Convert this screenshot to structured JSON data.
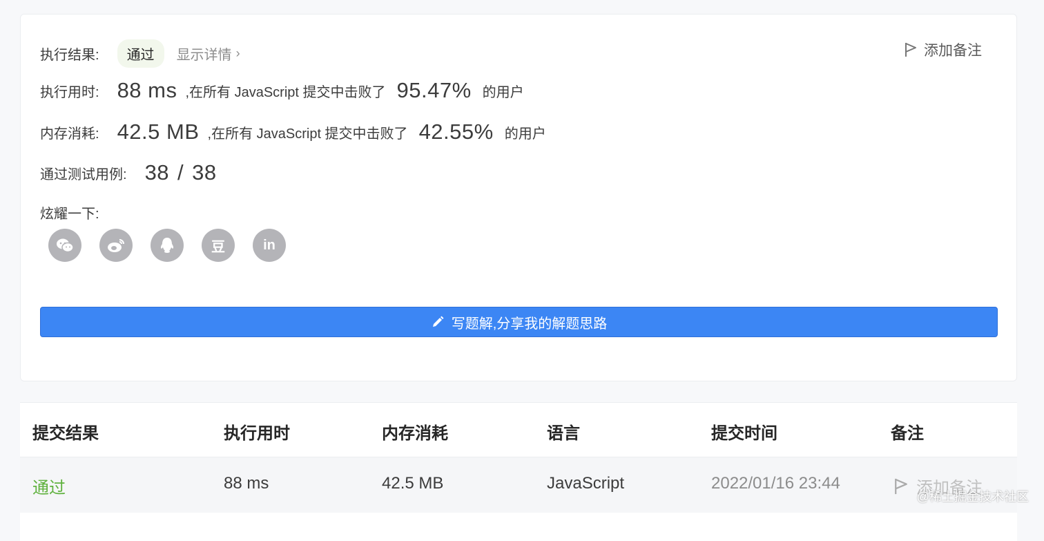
{
  "result": {
    "label": "执行结果:",
    "status": "通过",
    "detail_link": "显示详情",
    "add_note": "添加备注"
  },
  "runtime": {
    "label": "执行用时:",
    "value": "88 ms",
    "beat_text": ",在所有 JavaScript 提交中击败了",
    "percent": "95.47%",
    "suffix": "的用户"
  },
  "memory": {
    "label": "内存消耗:",
    "value": "42.5 MB",
    "beat_text": ",在所有 JavaScript 提交中击败了",
    "percent": "42.55%",
    "suffix": "的用户"
  },
  "testcases": {
    "label": "通过测试用例:",
    "passed": "38",
    "slash": "/",
    "total": "38"
  },
  "share": {
    "label": "炫耀一下:",
    "icons": [
      "wechat-icon",
      "weibo-icon",
      "qq-icon",
      "douban-icon",
      "linkedin-icon"
    ],
    "douban_glyph": "豆",
    "linkedin_glyph": "in"
  },
  "write_solution": "写题解,分享我的解题思路",
  "table": {
    "headers": [
      "提交结果",
      "执行用时",
      "内存消耗",
      "语言",
      "提交时间",
      "备注"
    ],
    "rows": [
      {
        "status": "通过",
        "runtime": "88 ms",
        "memory": "42.5 MB",
        "language": "JavaScript",
        "time": "2022/01/16 23:44",
        "note": "添加备注"
      }
    ]
  },
  "watermark": "@稀土掘金技术社区",
  "colors": {
    "primary": "#3c86f4",
    "success": "#5fb13e",
    "badge_bg": "#f2f7ec",
    "icon_gray": "#b4b4b8"
  }
}
